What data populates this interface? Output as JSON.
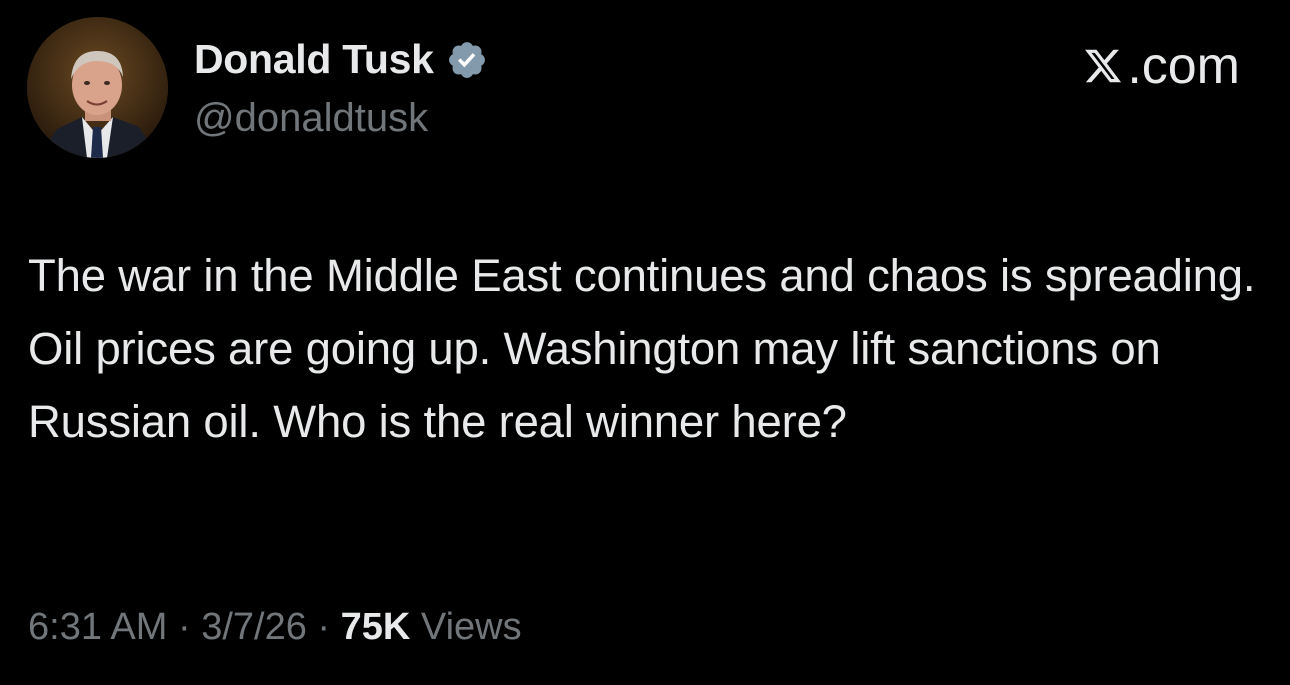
{
  "author": {
    "name": "Donald Tusk",
    "handle": "@donaldtusk",
    "verified_color": "#829aab"
  },
  "brand": {
    "label": ".com",
    "logo_letter": "X"
  },
  "tweet": {
    "text": "The war in the Middle East continues and chaos is spreading. Oil prices are going up. Washington may lift sanctions on Russian oil. Who is the real winner here?"
  },
  "meta": {
    "time": "6:31 AM",
    "separator": "·",
    "date": "3/7/26",
    "views_count": "75K",
    "views_label": "Views"
  },
  "colors": {
    "background": "#000000",
    "primary_text": "#e7e9ea",
    "secondary_text": "#71767b"
  }
}
